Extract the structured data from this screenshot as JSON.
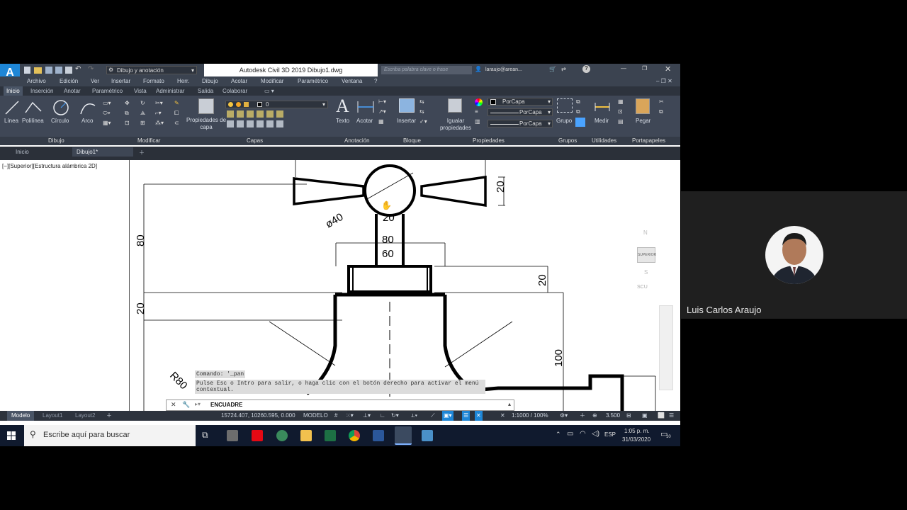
{
  "app": {
    "title": "Autodesk Civil 3D 2019   Dibujo1.dwg",
    "logo_text": "A",
    "workspace": "Dibujo y anotación",
    "search_placeholder": "Escriba palabra clave o frase",
    "user": "laraujo@arean..."
  },
  "menu": [
    "Archivo",
    "Edición",
    "Ver",
    "Insertar",
    "Formato",
    "Herr.",
    "Dibujo",
    "Acotar",
    "Modificar",
    "Paramétrico",
    "Ventana",
    "?"
  ],
  "ribbon_tabs": [
    "Inicio",
    "Inserción",
    "Anotar",
    "Paramétrico",
    "Vista",
    "Administrar",
    "Salida",
    "Colaborar"
  ],
  "ribbon": {
    "draw_tools": [
      "Línea",
      "Polilínea",
      "Círculo",
      "Arco"
    ],
    "layer_props": "Propiedades de capa",
    "layer_value": "0",
    "text": "Texto",
    "dimension": "Acotar",
    "insert": "Insertar",
    "match_props": "Igualar propiedades",
    "bylayer": [
      "PorCapa",
      "PorCapa",
      "PorCapa"
    ],
    "group": "Grupo",
    "measure": "Medir",
    "paste": "Pegar",
    "panels": [
      "Dibujo",
      "Modificar",
      "Capas",
      "Anotación",
      "Bloque",
      "Propiedades",
      "Grupos",
      "Utilidades",
      "Portapapeles"
    ]
  },
  "file_tabs": [
    "Inicio",
    "Dibujo1*"
  ],
  "viewport": {
    "label": "[−][Superior][Estructura alámbrica 2D]",
    "viewcube_top": "SUPERIOR",
    "viewcube_n": "N",
    "viewcube_s": "S",
    "wcs": "SCU"
  },
  "drawing": {
    "dims": [
      "20",
      "ø40",
      "20",
      "80",
      "60",
      "80",
      "20",
      "20",
      "100",
      "R80"
    ]
  },
  "command": {
    "history_1": "Comando: '_pan",
    "history_2": "Pulse Esc o Intro para salir, o haga clic con el botón derecho para activar el menú contextual.",
    "current": "ENCUADRE"
  },
  "layout_tabs": [
    "Modelo",
    "Layout1",
    "Layout2"
  ],
  "status": {
    "coords": "15724.407, 10260.595, 0.000",
    "space": "MODELO",
    "scale": "1:1000 / 100%",
    "decimal": "3.500"
  },
  "taskbar": {
    "search_placeholder": "Escribe aquí para buscar",
    "lang": "ESP",
    "time": "1:05 p. m.",
    "date": "31/03/2020",
    "notif_count": "10"
  },
  "participant": {
    "name": "Luis Carlos Araujo"
  },
  "colors": {
    "ribbon_bg": "#3f4756",
    "taskbar_bg": "#101a2e",
    "accent": "#1e86d6"
  }
}
